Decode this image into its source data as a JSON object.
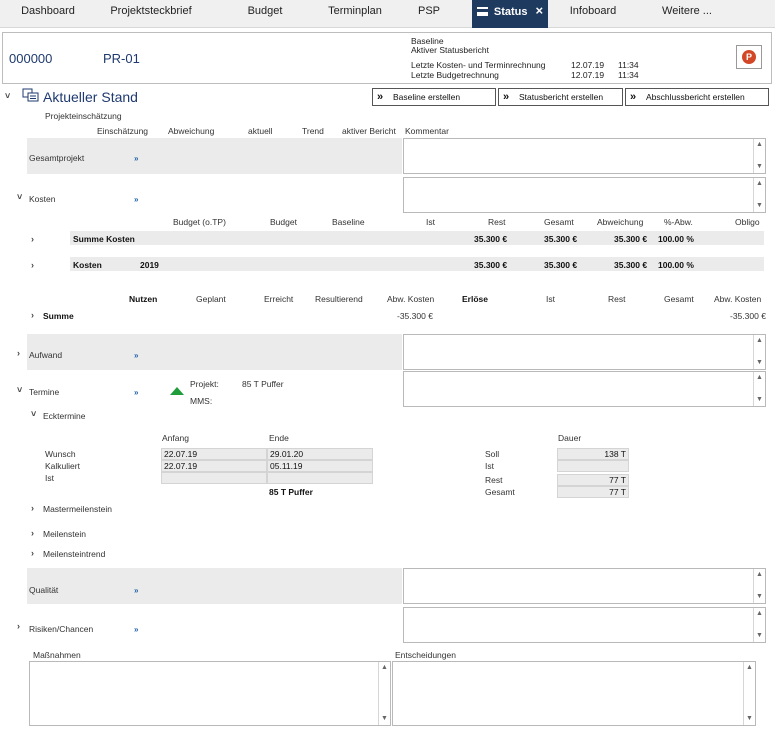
{
  "tabs": [
    {
      "label": "Dashboard"
    },
    {
      "label": "Projektsteckbrief"
    },
    {
      "label": "Budget"
    },
    {
      "label": "Terminplan"
    },
    {
      "label": "PSP"
    },
    {
      "label": "Status"
    },
    {
      "label": "Infoboard"
    },
    {
      "label": "Weitere ..."
    }
  ],
  "header": {
    "project_number": "000000",
    "project_code": "PR-01",
    "baseline_label": "Baseline",
    "status_report_label": "Aktiver Statusbericht",
    "last_cost_label": "Letzte Kosten- und Terminrechnung",
    "last_cost_date": "12.07.19",
    "last_cost_time": "11:34",
    "last_budget_label": "Letzte Budgetrechnung",
    "last_budget_date": "12.07.19",
    "last_budget_time": "11:34"
  },
  "section": {
    "title": "Aktueller Stand",
    "btn_baseline": "Baseline erstellen",
    "btn_status": "Statusbericht erstellen",
    "btn_final": "Abschlussbericht erstellen"
  },
  "assessment": {
    "title": "Projekteinschätzung",
    "columns": [
      "Einschätzung",
      "Abweichung",
      "aktuell",
      "Trend",
      "aktiver Bericht",
      "Kommentar"
    ],
    "gesamtprojekt": "Gesamtprojekt",
    "kosten": "Kosten",
    "aufwand": "Aufwand",
    "termine": "Termine",
    "qualitaet": "Qualität",
    "risiken": "Risiken/Chancen",
    "more": "»"
  },
  "costs": {
    "columns": [
      "Budget (o.TP)",
      "Budget",
      "Baseline",
      "Ist",
      "Rest",
      "Gesamt",
      "Abweichung",
      "%-Abw.",
      "Obligo"
    ],
    "rows": [
      {
        "label": "Summe Kosten",
        "year": "",
        "rest": "35.300 €",
        "gesamt": "35.300 €",
        "abw": "35.300 €",
        "pct": "100.00 %"
      },
      {
        "label": "Kosten",
        "year": "2019",
        "rest": "35.300 €",
        "gesamt": "35.300 €",
        "abw": "35.300 €",
        "pct": "100.00 %"
      }
    ]
  },
  "benefit": {
    "columns": [
      "Nutzen",
      "Geplant",
      "Erreicht",
      "Resultierend",
      "Abw. Kosten",
      "Erlöse",
      "Ist",
      "Rest",
      "Gesamt",
      "Abw. Kosten"
    ],
    "row_label": "Summe",
    "abw_kosten": "-35.300 €",
    "abw_kosten2": "-35.300 €"
  },
  "termine": {
    "projekt_label": "Projekt:",
    "projekt_value": "85 T Puffer",
    "mms_label": "MMS:",
    "ecktermine": "Ecktermine",
    "anfang": "Anfang",
    "ende": "Ende",
    "dauer": "Dauer",
    "wunsch": "Wunsch",
    "kalkuliert": "Kalkuliert",
    "ist": "Ist",
    "wunsch_anfang": "22.07.19",
    "wunsch_ende": "29.01.20",
    "kalk_anfang": "22.07.19",
    "kalk_ende": "05.11.19",
    "puffer": "85 T Puffer",
    "soll_label": "Soll",
    "soll_value": "138 T",
    "ist_label": "Ist",
    "rest_label": "Rest",
    "rest_value": "77 T",
    "gesamt_label": "Gesamt",
    "gesamt_value": "77 T",
    "mastermeilenstein": "Mastermeilenstein",
    "meilenstein": "Meilenstein",
    "meilensteintrend": "Meilensteintrend"
  },
  "bottom": {
    "massnahmen": "Maßnahmen",
    "entscheidungen": "Entscheidungen"
  },
  "icons": {
    "collapse": "chevron-down-icon",
    "expand": "chevron-right-icon",
    "scroll_up": "▲",
    "scroll_down": "▼"
  },
  "colors": {
    "active_tab": "#1f3a5f",
    "accent_text": "#1f3a6f",
    "trend_up": "#1f9d3a",
    "ppt_icon": "#d24726"
  }
}
